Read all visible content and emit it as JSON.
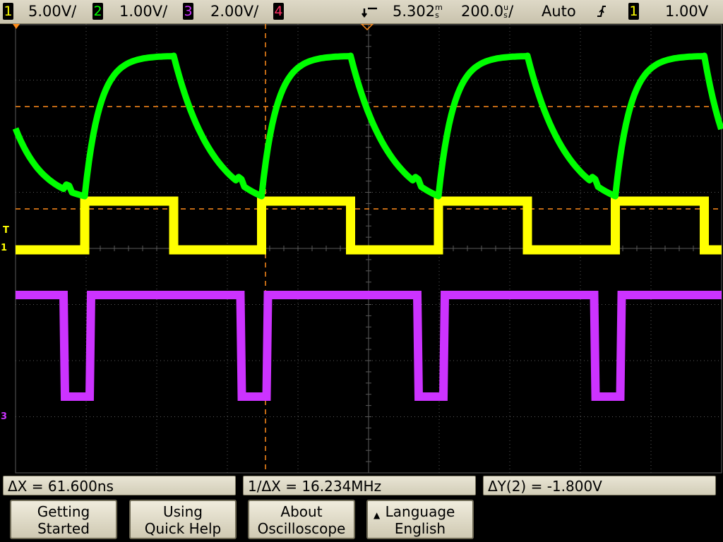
{
  "channels": [
    {
      "num": "1",
      "scale": "5.00V/",
      "color": "#ffff00"
    },
    {
      "num": "2",
      "scale": "1.00V/",
      "color": "#00ff00"
    },
    {
      "num": "3",
      "scale": "2.00V/",
      "color": "#cc33ff"
    },
    {
      "num": "4",
      "scale": "",
      "color": "#ff3366"
    }
  ],
  "timebase": {
    "delay": "5.302",
    "delay_unit": "s",
    "delay_prefix": "m",
    "scale": "200.0",
    "scale_prefix": "u",
    "scale_unit": "s/"
  },
  "trigger": {
    "mode": "Auto",
    "edge_icon": "rising-edge-icon",
    "source": "1",
    "level": "1.00V"
  },
  "markers": {
    "trigger_marker": "T",
    "ch1_ground_marker": "1",
    "ch3_ground_marker": "3"
  },
  "measurements": {
    "delta_x": "ΔX = 61.600ns",
    "inv_delta_x": "1/ΔX = 16.234MHz",
    "delta_y": "ΔY(2) = -1.800V"
  },
  "softkeys": [
    {
      "line1": "Getting",
      "line2": "Started"
    },
    {
      "line1": "Using",
      "line2": "Quick Help"
    },
    {
      "line1": "About",
      "line2": "Oscilloscope"
    },
    {
      "line1": "Language",
      "line2": "English",
      "icon": "up-triangle-icon"
    }
  ],
  "colors": {
    "grid": "#5a5a5a",
    "cursor": "#ff8c1a",
    "background": "#000000"
  }
}
